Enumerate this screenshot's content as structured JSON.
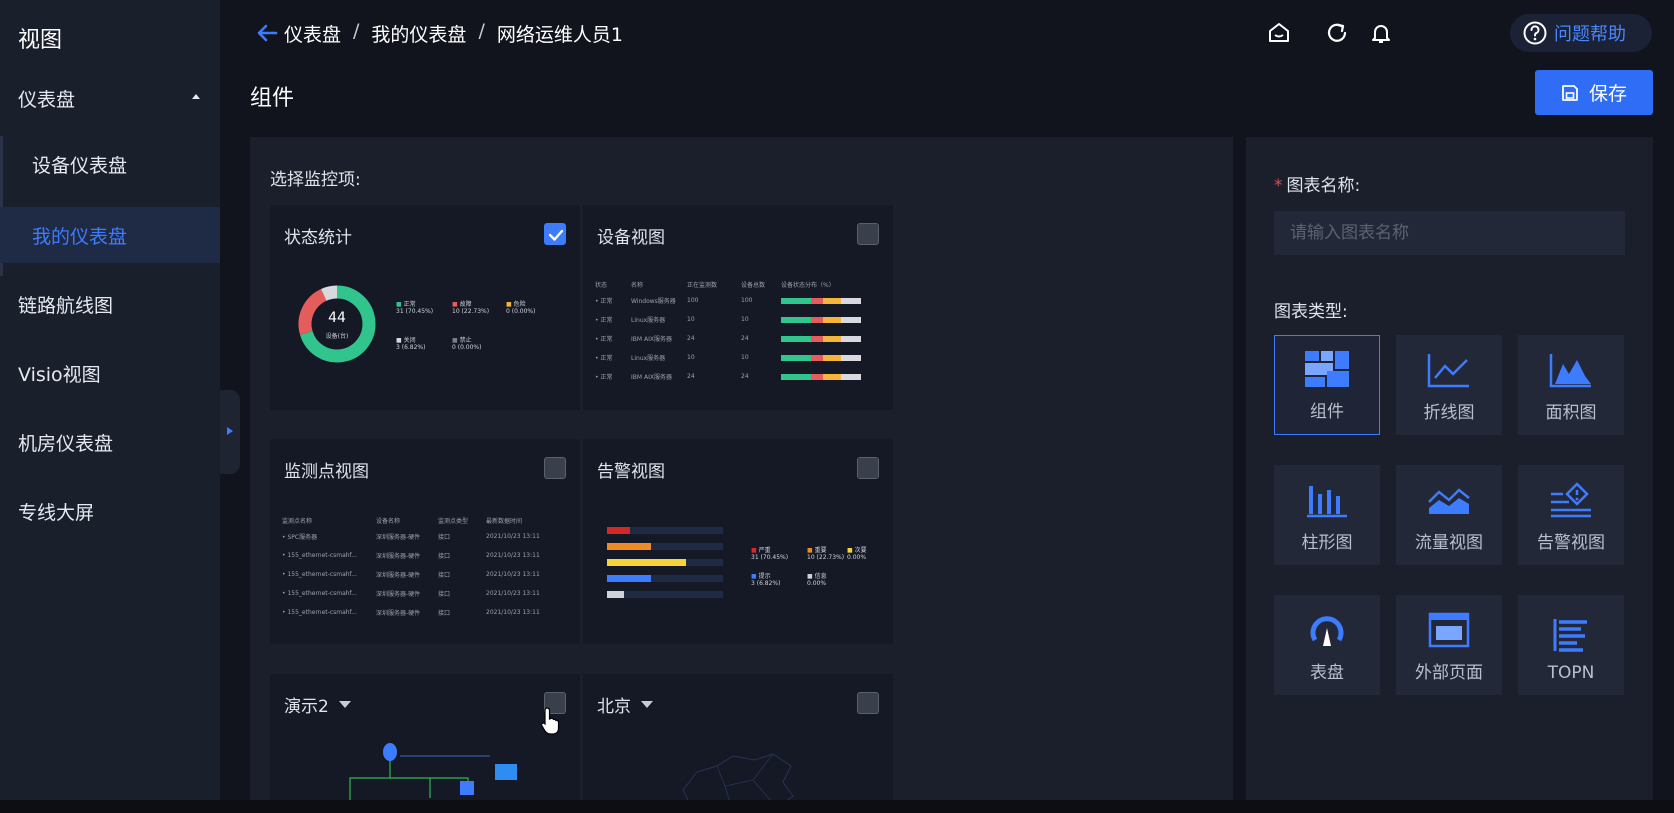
{
  "app": {
    "title": "视图"
  },
  "sidebar": {
    "items": [
      {
        "label": "仪表盘"
      },
      {
        "label": "设备仪表盘"
      },
      {
        "label": "我的仪表盘"
      },
      {
        "label": "链路航线图"
      },
      {
        "label": "Visio视图"
      },
      {
        "label": "机房仪表盘"
      },
      {
        "label": "专线大屏"
      }
    ]
  },
  "header": {
    "breadcrumb": [
      "仪表盘",
      "/",
      "我的仪表盘",
      "/",
      "网络运维人员1"
    ],
    "help_label": "问题帮助",
    "icons": [
      "home-icon",
      "refresh-icon",
      "bell-icon",
      "question-icon"
    ]
  },
  "page": {
    "title": "组件",
    "save_label": "保存"
  },
  "selector": {
    "label": "选择监控项:",
    "cards": [
      {
        "title": "状态统计",
        "checked": true
      },
      {
        "title": "设备视图",
        "checked": false
      },
      {
        "title": "监测点视图",
        "checked": false
      },
      {
        "title": "告警视图",
        "checked": false
      },
      {
        "title": "演示2",
        "checked": false
      },
      {
        "title": "北京",
        "checked": false
      }
    ],
    "status_card": {
      "center_value": "44",
      "center_label": "设备(台)",
      "legend": [
        {
          "name": "正常",
          "detail": "31 (70.45%)"
        },
        {
          "name": "故障",
          "detail": "10 (22.73%)"
        },
        {
          "name": "危险",
          "detail": "0 (0.00%)"
        },
        {
          "name": "关闭",
          "detail": "3 (6.82%)"
        },
        {
          "name": "禁止",
          "detail": "0 (0.00%)"
        }
      ],
      "chart_data": {
        "type": "pie",
        "categories": [
          "正常",
          "故障",
          "危险",
          "关闭",
          "禁止"
        ],
        "values": [
          31,
          10,
          0,
          3,
          0
        ],
        "colors": [
          "#31c48d",
          "#e45c5c",
          "#f3b63b",
          "#d7d9de",
          "#7a7f8a"
        ]
      }
    },
    "device_card": {
      "headers": [
        "状态",
        "名称",
        "正在监测数",
        "设备总数",
        "设备状态分布（%）"
      ],
      "rows": [
        [
          "正常",
          "Windows服务器",
          "100",
          "100"
        ],
        [
          "正常",
          "Linux服务器",
          "10",
          "10"
        ],
        [
          "正常",
          "IBM AIX服务器",
          "24",
          "24"
        ],
        [
          "正常",
          "Linux服务器",
          "10",
          "10"
        ],
        [
          "正常",
          "IBM AIX服务器",
          "24",
          "24"
        ]
      ]
    },
    "monitor_card": {
      "headers": [
        "监测点名称",
        "设备名称",
        "监测点类型",
        "最新数据时间"
      ],
      "rows": [
        [
          "SPC服务器",
          "深圳服务器-硬件",
          "接口",
          "2021/10/23 13:11"
        ],
        [
          "155_ethernet-csmahf...",
          "深圳服务器-硬件",
          "接口",
          "2021/10/23 13:11"
        ],
        [
          "155_ethernet-csmahf...",
          "深圳服务器-硬件",
          "接口",
          "2021/10/23 13:11"
        ],
        [
          "155_ethernet-csmahf...",
          "深圳服务器-硬件",
          "接口",
          "2021/10/23 13:11"
        ],
        [
          "155_ethernet-csmahf...",
          "深圳服务器-硬件",
          "接口",
          "2021/10/23 13:11"
        ]
      ]
    },
    "alarm_card": {
      "legend": [
        {
          "name": "严重",
          "detail": "31 (70.45%)"
        },
        {
          "name": "重要",
          "detail": "10 (22.73%)"
        },
        {
          "name": "次要",
          "detail": "0.00%"
        },
        {
          "name": "提示",
          "detail": "3 (6.82%)"
        },
        {
          "name": "信息",
          "detail": "0.00%"
        }
      ],
      "chart_data": {
        "type": "bar",
        "categories": [
          "严重",
          "重要",
          "次要",
          "提示",
          "信息"
        ],
        "values": [
          0.2,
          0.38,
          0.68,
          0.38,
          0.15
        ],
        "colors": [
          "#d42828",
          "#f08a24",
          "#f5d33b",
          "#3d7bff",
          "#cfd2d8"
        ]
      }
    }
  },
  "form": {
    "name_label": "图表名称:",
    "name_required_mark": "*",
    "name_placeholder": "请输入图表名称",
    "type_label": "图表类型:",
    "types": [
      {
        "label": "组件",
        "icon": "widget-icon",
        "selected": true
      },
      {
        "label": "折线图",
        "icon": "line-chart-icon",
        "selected": false
      },
      {
        "label": "面积图",
        "icon": "area-chart-icon",
        "selected": false
      },
      {
        "label": "柱形图",
        "icon": "bar-chart-icon",
        "selected": false
      },
      {
        "label": "流量视图",
        "icon": "traffic-icon",
        "selected": false
      },
      {
        "label": "告警视图",
        "icon": "alarm-icon",
        "selected": false
      },
      {
        "label": "表盘",
        "icon": "gauge-icon",
        "selected": false
      },
      {
        "label": "外部页面",
        "icon": "external-page-icon",
        "selected": false
      },
      {
        "label": "TOPN",
        "icon": "topn-icon",
        "selected": false
      }
    ]
  },
  "colors": {
    "accent": "#3d7bff",
    "sidebar_bg": "#1a1f2c",
    "page_bg": "#11141d"
  }
}
